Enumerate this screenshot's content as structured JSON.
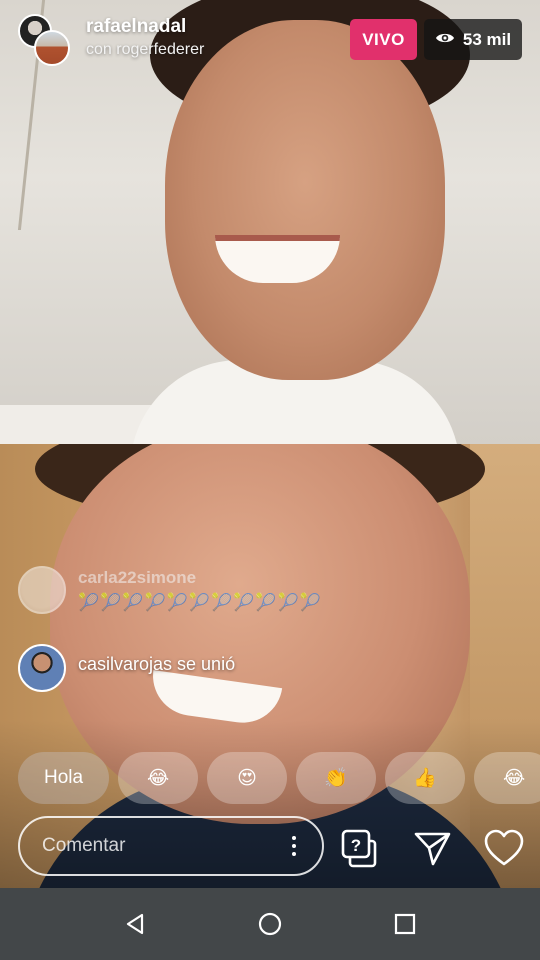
{
  "header": {
    "host_username": "rafaelnadal",
    "guest_line": "con rogerfederer",
    "live_label": "VIVO",
    "viewer_count": "53 mil",
    "live_color": "#e1306c"
  },
  "comments": [
    {
      "username": "carla22simone",
      "text": "🎾🎾🎾🎾🎾🎾🎾🎾🎾🎾🎾"
    },
    {
      "text": "casilvarojas se unió"
    }
  ],
  "quick_reactions": [
    "Hola",
    "😂",
    "😍",
    "👏",
    "👍",
    "😂"
  ],
  "comment_input": {
    "placeholder": "Comentar"
  },
  "icons": {
    "header": [
      "eye-icon"
    ],
    "actions": [
      "more-options-icon",
      "question-icon",
      "send-icon",
      "heart-icon"
    ],
    "nav": [
      "back-icon",
      "home-icon",
      "recents-icon"
    ]
  }
}
